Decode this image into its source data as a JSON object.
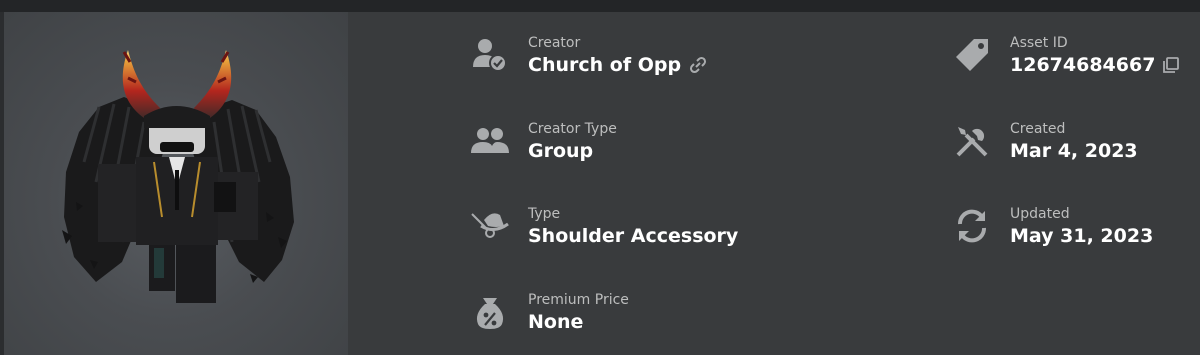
{
  "item": {
    "thumbnail_icon": "avatar-accessory-render"
  },
  "details_left": [
    {
      "icon": "creator-badge-icon",
      "label": "Creator",
      "value": "Church of Opp",
      "value_icon": "link-icon"
    },
    {
      "icon": "group-icon",
      "label": "Creator Type",
      "value": "Group"
    },
    {
      "icon": "accessory-type-icon",
      "label": "Type",
      "value": "Shoulder Accessory"
    },
    {
      "icon": "premium-price-icon",
      "label": "Premium Price",
      "value": "None"
    }
  ],
  "details_right": [
    {
      "icon": "tag-icon",
      "label": "Asset ID",
      "value": "12674684667",
      "value_icon": "copy-icon"
    },
    {
      "icon": "tools-icon",
      "label": "Created",
      "value": "Mar 4, 2023"
    },
    {
      "icon": "refresh-icon",
      "label": "Updated",
      "value": "May 31, 2023"
    }
  ],
  "colors": {
    "page_bg": "#232527",
    "card_bg": "#393b3d",
    "label": "#bdbebe",
    "value": "#ffffff",
    "icon": "#a9abad"
  }
}
